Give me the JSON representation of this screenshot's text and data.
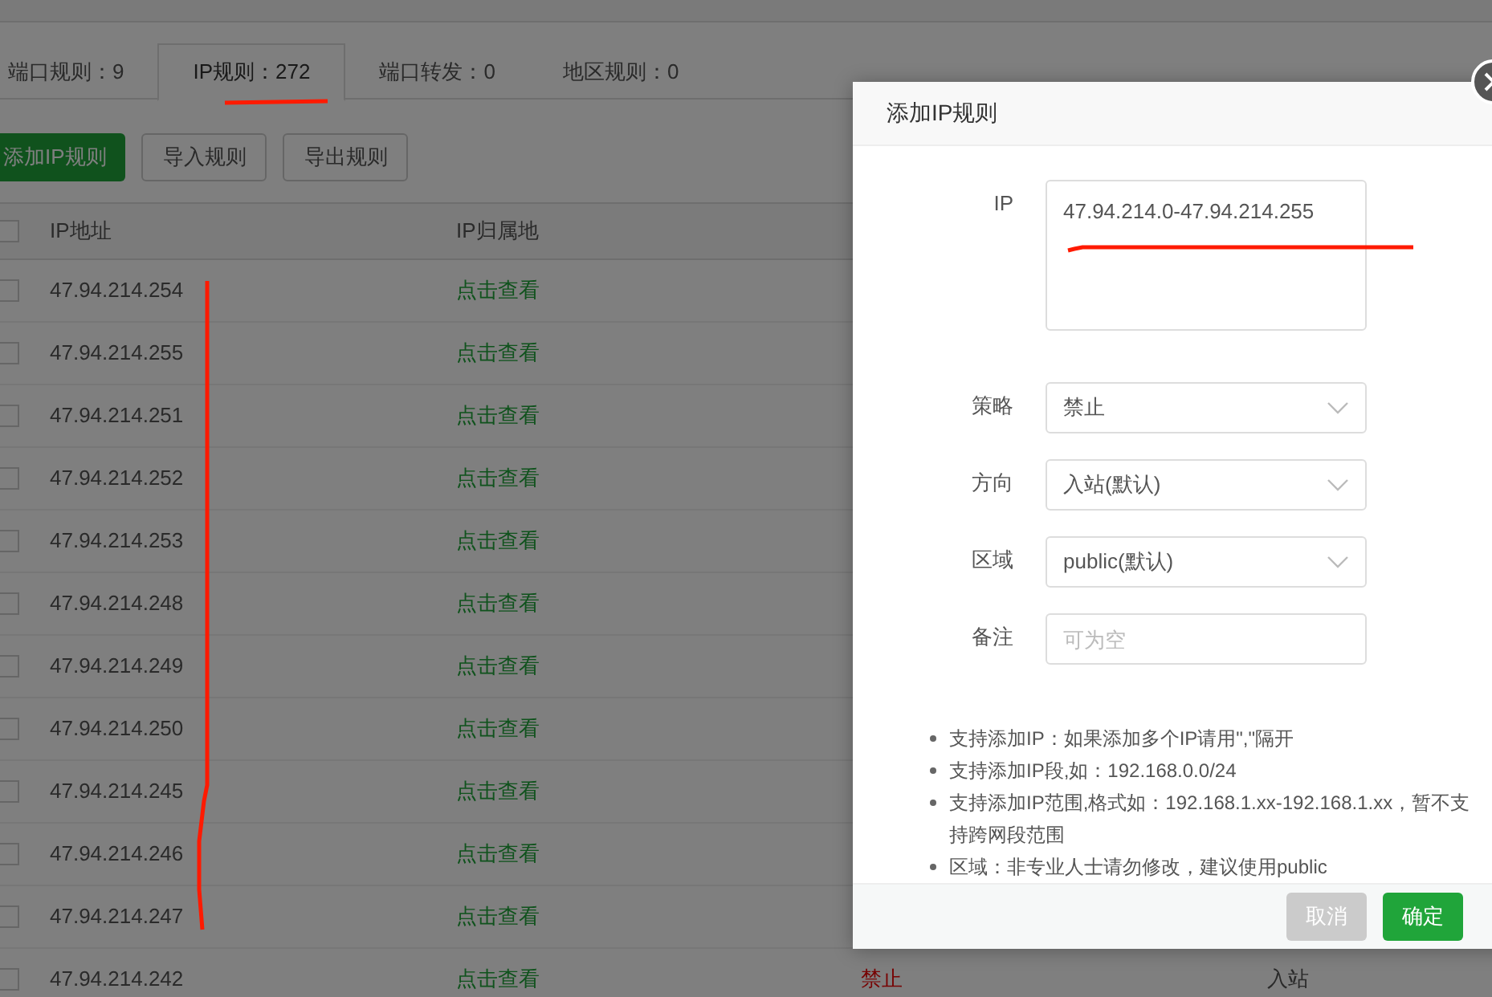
{
  "tabs": [
    {
      "label": "端口规则：9",
      "selected": false
    },
    {
      "label": "IP规则：272",
      "selected": true
    },
    {
      "label": "端口转发：0",
      "selected": false
    },
    {
      "label": "地区规则：0",
      "selected": false
    }
  ],
  "toolbar": [
    {
      "label": "添加IP规则",
      "kind": "primary"
    },
    {
      "label": "导入规则",
      "kind": "default"
    },
    {
      "label": "导出规则",
      "kind": "default"
    }
  ],
  "table": {
    "columns": [
      "IP地址",
      "IP归属地"
    ],
    "all_checked": false,
    "rows": [
      {
        "ip": "47.94.214.254",
        "location": "点击查看",
        "checked": false
      },
      {
        "ip": "47.94.214.255",
        "location": "点击查看",
        "checked": false
      },
      {
        "ip": "47.94.214.251",
        "location": "点击查看",
        "checked": false
      },
      {
        "ip": "47.94.214.252",
        "location": "点击查看",
        "checked": false
      },
      {
        "ip": "47.94.214.253",
        "location": "点击查看",
        "checked": false
      },
      {
        "ip": "47.94.214.248",
        "location": "点击查看",
        "checked": false
      },
      {
        "ip": "47.94.214.249",
        "location": "点击查看",
        "checked": false
      },
      {
        "ip": "47.94.214.250",
        "location": "点击查看",
        "checked": false
      },
      {
        "ip": "47.94.214.245",
        "location": "点击查看",
        "checked": false
      },
      {
        "ip": "47.94.214.246",
        "location": "点击查看",
        "checked": false
      },
      {
        "ip": "47.94.214.247",
        "location": "点击查看",
        "checked": false
      },
      {
        "ip": "47.94.214.242",
        "location": "点击查看",
        "policy": "禁止",
        "direction": "入站",
        "checked": false
      }
    ]
  },
  "dialog": {
    "title": "添加IP规则",
    "fields": [
      {
        "label": "IP",
        "kind": "textarea",
        "value": "47.94.214.0-47.94.214.255"
      },
      {
        "label": "策略",
        "kind": "select",
        "value": "禁止"
      },
      {
        "label": "方向",
        "kind": "select",
        "value": "入站(默认)"
      },
      {
        "label": "区域",
        "kind": "select",
        "value": "public(默认)"
      },
      {
        "label": "备注",
        "kind": "input",
        "placeholder": "可为空"
      }
    ],
    "notes": [
      "支持添加IP：如果添加多个IP请用\",\"隔开",
      "支持添加IP段,如：192.168.0.0/24",
      "支持添加IP范围,格式如：192.168.1.xx-192.168.1.xx，暂不支持跨网段范围",
      "区域：非专业人士请勿修改，建议使用public"
    ],
    "buttons": [
      {
        "label": "取消",
        "kind": "cancel"
      },
      {
        "label": "确定",
        "kind": "confirm"
      }
    ]
  }
}
